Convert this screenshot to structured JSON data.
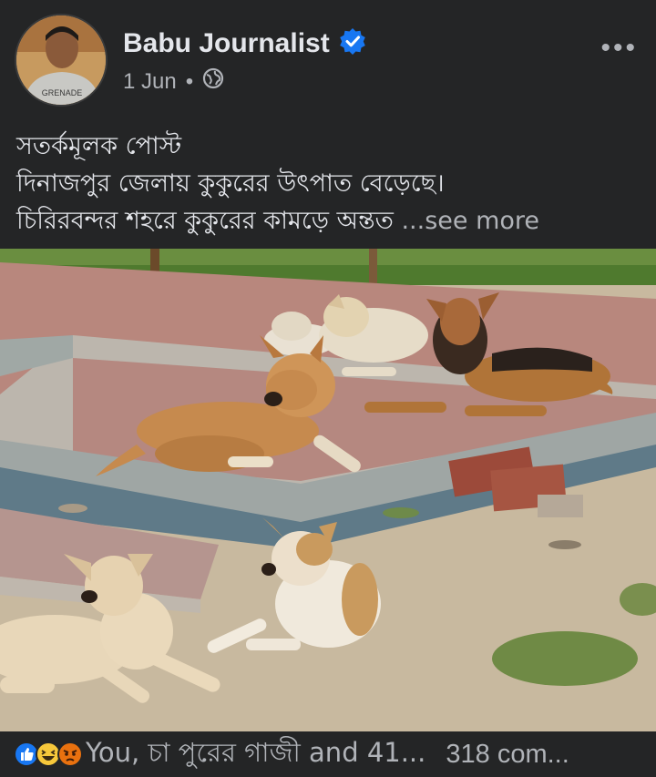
{
  "post": {
    "author": "Babu Journalist",
    "verified": true,
    "date": "1 Jun",
    "separator": "•",
    "privacy_icon": "globe-icon",
    "more_label": "•••",
    "text_lines": [
      "সতর্কমূলক পোস্ট",
      "দিনাজপুর জেলায় কুকুরের উৎপাত বেড়েছে।",
      "চিরিরবন্দর শহরে কুকুরের কামড়ে অন্তত"
    ],
    "see_more": "...see more",
    "avatar_shirt_text": "GRENADE"
  },
  "footer": {
    "reaction_icons": [
      "like-icon",
      "haha-icon",
      "angry-icon"
    ],
    "reactions_text": "You, চা পুরের গাজী and 41...",
    "comments_text": "318 com..."
  },
  "colors": {
    "background": "#242526",
    "primary_text": "#e4e6eb",
    "secondary_text": "#b0b3b8",
    "verified": "#1877f2"
  }
}
